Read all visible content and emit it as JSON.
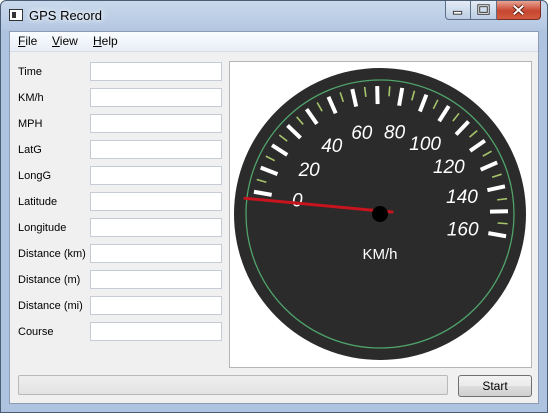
{
  "window": {
    "title": "GPS Record"
  },
  "menu": [
    {
      "accel": "F",
      "rest": "ile"
    },
    {
      "accel": "V",
      "rest": "iew"
    },
    {
      "accel": "H",
      "rest": "elp"
    }
  ],
  "fields": [
    {
      "label": "Time",
      "value": ""
    },
    {
      "label": "KM/h",
      "value": ""
    },
    {
      "label": "MPH",
      "value": ""
    },
    {
      "label": "LatG",
      "value": ""
    },
    {
      "label": "LongG",
      "value": ""
    },
    {
      "label": "Latitude",
      "value": ""
    },
    {
      "label": "Longitude",
      "value": ""
    },
    {
      "label": "Distance (km)",
      "value": ""
    },
    {
      "label": "Distance (m)",
      "value": ""
    },
    {
      "label": "Distance (mi)",
      "value": ""
    },
    {
      "label": "Course",
      "value": ""
    }
  ],
  "gauge": {
    "unit": "KM/h",
    "labels": [
      "0",
      "20",
      "40",
      "60",
      "80",
      "100",
      "120",
      "140",
      "160"
    ],
    "min": 0,
    "max": 160,
    "value": -3,
    "colors": {
      "face": "#2b2b2b",
      "ring": "#4fa36a",
      "needle": "#c8141e",
      "minor_tick": "#a6c46a",
      "text": "#ffffff"
    }
  },
  "progress": {
    "value": 0
  },
  "start_button": {
    "label": "Start"
  }
}
